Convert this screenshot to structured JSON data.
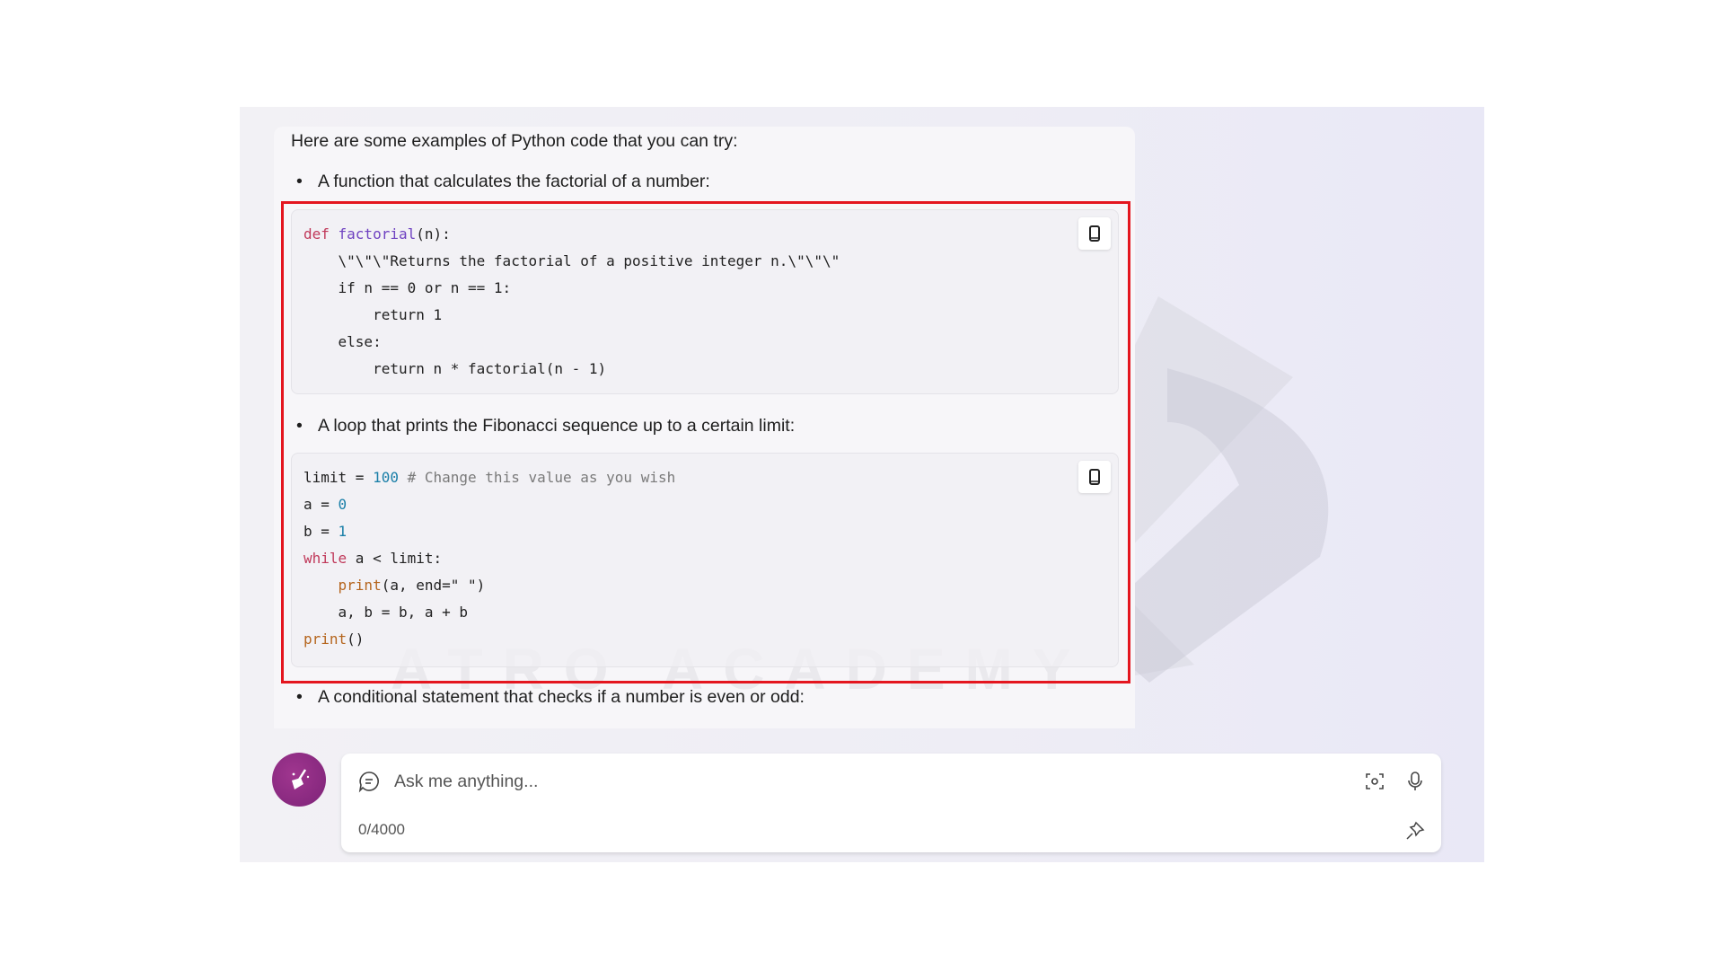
{
  "message": {
    "intro": "Here are some examples of Python code that you can try:",
    "bullets": [
      "A function that calculates the factorial of a number:",
      "A loop that prints the Fibonacci sequence up to a certain limit:",
      "A conditional statement that checks if a number is even or odd:"
    ],
    "code_blocks": [
      {
        "lines": [
          [
            [
              "kw",
              "def "
            ],
            [
              "fn",
              "factorial"
            ],
            [
              "tx",
              "(n):"
            ]
          ],
          [
            [
              "tx",
              "    \\\"\\\"\\\"Returns the factorial of a positive integer n.\\\"\\\"\\\""
            ]
          ],
          [
            [
              "tx",
              "    if n == 0 or n == 1:"
            ]
          ],
          [
            [
              "tx",
              "        return 1"
            ]
          ],
          [
            [
              "tx",
              "    else:"
            ]
          ],
          [
            [
              "tx",
              "        return n * factorial(n - 1)"
            ]
          ]
        ]
      },
      {
        "lines": [
          [
            [
              "tx",
              "limit = "
            ],
            [
              "num",
              "100"
            ],
            [
              "cm",
              " # Change this value as you wish"
            ]
          ],
          [
            [
              "tx",
              "a = "
            ],
            [
              "num",
              "0"
            ]
          ],
          [
            [
              "tx",
              "b = "
            ],
            [
              "num",
              "1"
            ]
          ],
          [
            [
              "kw",
              "while"
            ],
            [
              "tx",
              " a < limit:"
            ]
          ],
          [
            [
              "tx",
              "    "
            ],
            [
              "bi",
              "print"
            ],
            [
              "tx",
              "(a, end=\" \")"
            ]
          ],
          [
            [
              "tx",
              "    a, b = b, a + b"
            ]
          ],
          [
            [
              "bi",
              "print"
            ],
            [
              "tx",
              "()"
            ]
          ]
        ]
      }
    ],
    "copy_icon": "copy-icon"
  },
  "watermark": {
    "text": "ATRO ACADEMY"
  },
  "composer": {
    "placeholder": "Ask me anything...",
    "counter": "0/4000",
    "icons": [
      "new-topic-broom-icon",
      "chat-bubble-icon",
      "visual-search-icon",
      "microphone-icon",
      "pin-icon"
    ]
  },
  "colors": {
    "highlight_border": "#e4161f",
    "avatar": "#8e2a84",
    "keyword": "#c0395a",
    "number": "#1a7fa8",
    "builtin": "#b5651d"
  }
}
